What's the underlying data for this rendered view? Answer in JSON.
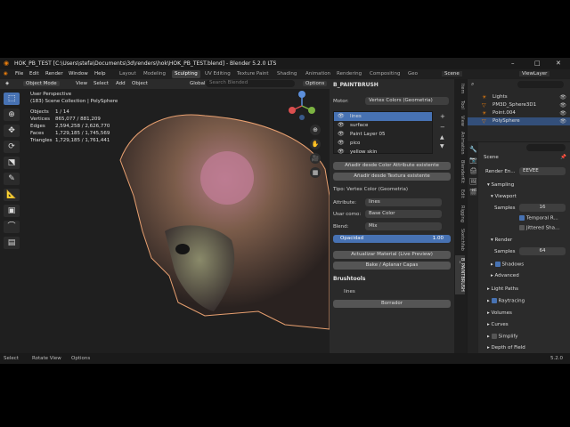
{
  "titlebar": {
    "title": "HOK_PB_TEST [C:\\Users\\stefa\\Documents\\3d\\renders\\hok\\HOK_PB_TEST.blend] - Blender 5.2.0 LTS",
    "min": "–",
    "max": "□",
    "close": "✕"
  },
  "menu": {
    "items": [
      "File",
      "Edit",
      "Render",
      "Window",
      "Help"
    ],
    "workspaces": [
      "Layout",
      "Modeling",
      "Sculpting",
      "UV Editing",
      "Texture Paint",
      "Shading",
      "Animation",
      "Rendering",
      "Compositing",
      "Geo"
    ],
    "active_workspace": "Sculpting",
    "scene": "Scene",
    "view_layer": "ViewLayer"
  },
  "header": {
    "mode": "Object Mode",
    "view": "View",
    "select": "Select",
    "add": "Add",
    "object": "Object",
    "orientation": "Global",
    "search_placeholder": "Search Blended",
    "options": "Options"
  },
  "viewport": {
    "view_name": "User Perspective",
    "collection": "(183) Scene Collection | PolySphere",
    "stats": [
      {
        "k": "Objects",
        "v": "1 / 14"
      },
      {
        "k": "Vertices",
        "v": "865,077 / 881,209"
      },
      {
        "k": "Edges",
        "v": "2,594,258 / 2,626,770"
      },
      {
        "k": "Faces",
        "v": "1,729,185 / 1,745,569"
      },
      {
        "k": "Triangles",
        "v": "1,729,185 / 1,761,441"
      }
    ]
  },
  "npanel": {
    "title": "B_PAINTBRUSH",
    "motor_label": "Motor:",
    "motor_value": "Vertex Colors (Geometria)",
    "layers": [
      "lines",
      "surface",
      "Paint Layer 05",
      "pico",
      "yellow skin"
    ],
    "active_layer": "lines",
    "add_color_attr": "Añadir desde Color Attribute existente",
    "add_texture": "Añadir desde Textura existente",
    "type_line": "Tipo: Vertex Color (Geometria)",
    "attribute_label": "Attribute:",
    "attribute_value": "lines",
    "use_as_label": "Usar como:",
    "use_as_value": "Base Color",
    "blend_label": "Blend:",
    "blend_value": "Mix",
    "opacity_label": "Opacidad",
    "opacity_value": "1.00",
    "opacity_fraction": 1.0,
    "update_material": "Actualizar Material (Live Preview)",
    "bake": "Bake / Aplanar Capas",
    "brushtools": "Brushtools",
    "brush_name": "lines",
    "erase": "Borrador"
  },
  "ntabs": [
    "Item",
    "Tool",
    "View",
    "Animation",
    "BlenderKit",
    "Edit",
    "Rigging",
    "Sketchfab",
    "B_PAINTBRUSH"
  ],
  "ntab_active": "B_PAINTBRUSH",
  "outliner": {
    "search_placeholder": "",
    "items": [
      "Lights",
      "PM3D_Sphere3D1",
      "Point.004",
      "PolySphere"
    ],
    "selected": "PolySphere"
  },
  "properties": {
    "search_placeholder": "",
    "scene": "Scene",
    "render_engine_label": "Render En...",
    "render_engine": "EEVEE",
    "sampling": "Sampling",
    "viewport": "Viewport",
    "samples_label": "Samples",
    "viewport_samples": "16",
    "temporal": "Temporal R...",
    "jittered": "Jittered Sha...",
    "render": "Render",
    "render_samples": "64",
    "shadows": "Shadows",
    "advanced": "Advanced",
    "light_paths": "Light Paths",
    "raytracing": "Raytracing",
    "volumes": "Volumes",
    "curves": "Curves",
    "simplify": "Simplify",
    "depth_of_field": "Depth of Field"
  },
  "status": {
    "select": "Select",
    "rotate": "Rotate View",
    "options": "Options",
    "version": "5.2.0"
  },
  "colors": {
    "accent": "#4772b3",
    "bg": "#1d1d1d"
  }
}
